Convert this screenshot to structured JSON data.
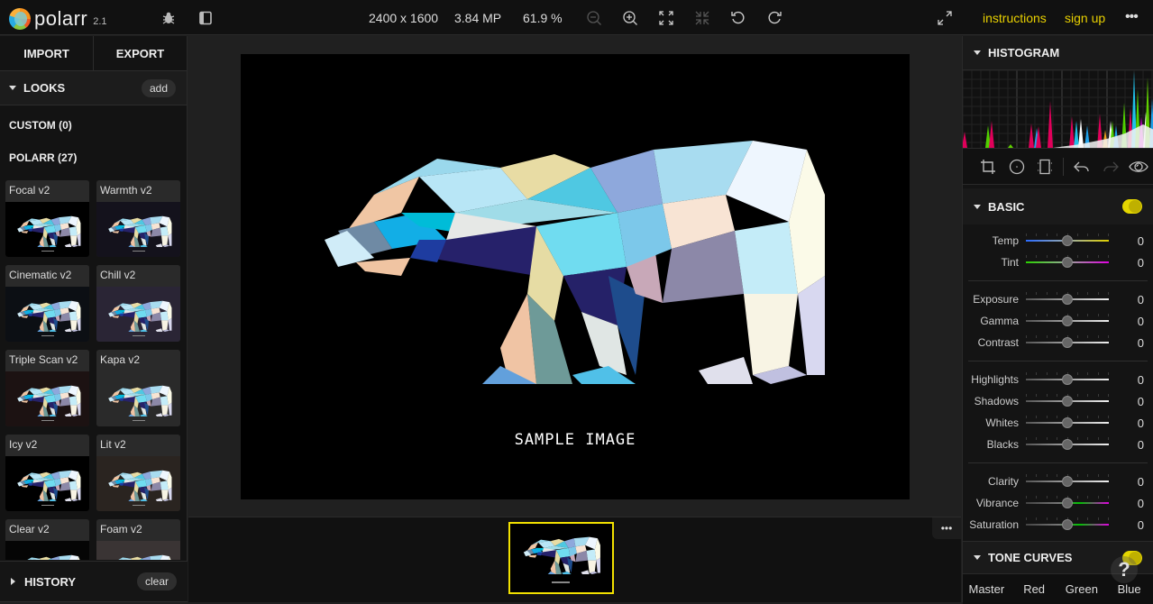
{
  "app": {
    "name": "polarr",
    "version": "2.1"
  },
  "topbar": {
    "dimensions": "2400 x 1600",
    "megapixels": "3.84 MP",
    "zoom": "61.9 %",
    "icons": [
      "bug-icon",
      "sidebar-toggle-icon",
      "zoom-out-icon",
      "zoom-in-icon",
      "fit-screen-icon",
      "actual-size-icon",
      "undo-icon",
      "redo-icon",
      "fullscreen-icon"
    ],
    "instructions_label": "instructions",
    "signup_label": "sign up",
    "more_label": "•••"
  },
  "left": {
    "import_label": "IMPORT",
    "export_label": "EXPORT",
    "looks_label": "LOOKS",
    "add_label": "add",
    "custom_label": "CUSTOM (0)",
    "polarr_label": "POLARR (27)",
    "looks": [
      {
        "name": "Focal v2",
        "bg": "#000000"
      },
      {
        "name": "Warmth v2",
        "bg": "#14121c"
      },
      {
        "name": "Cinematic v2",
        "bg": "#0c0f14"
      },
      {
        "name": "Chill v2",
        "bg": "#2a2535"
      },
      {
        "name": "Triple Scan v2",
        "bg": "#1c1212"
      },
      {
        "name": "Kapa v2",
        "bg": "#2a2a2a"
      },
      {
        "name": "Icy v2",
        "bg": "#000000"
      },
      {
        "name": "Lit v2",
        "bg": "#2a2420"
      },
      {
        "name": "Clear v2",
        "bg": "#050505"
      },
      {
        "name": "Foam v2",
        "bg": "#3a3434"
      }
    ],
    "history_label": "HISTORY",
    "clear_label": "clear"
  },
  "canvas": {
    "caption": "SAMPLE IMAGE",
    "filmstrip_more": "•••"
  },
  "right": {
    "histogram_label": "HISTOGRAM",
    "basic_label": "BASIC",
    "basic_enabled": true,
    "sliders": [
      {
        "label": "Temp",
        "value": "0",
        "group": 0,
        "gradient": "linear-gradient(to right,#2a6bff,#9aa 50%,#e0d000)"
      },
      {
        "label": "Tint",
        "value": "0",
        "group": 0,
        "gradient": "linear-gradient(to right,#2ad000,#9a9 50%,#e000e0)"
      },
      {
        "label": "Exposure",
        "value": "0",
        "group": 1
      },
      {
        "label": "Gamma",
        "value": "0",
        "group": 1
      },
      {
        "label": "Contrast",
        "value": "0",
        "group": 1
      },
      {
        "label": "Highlights",
        "value": "0",
        "group": 2
      },
      {
        "label": "Shadows",
        "value": "0",
        "group": 2
      },
      {
        "label": "Whites",
        "value": "0",
        "group": 2
      },
      {
        "label": "Blacks",
        "value": "0",
        "group": 2
      },
      {
        "label": "Clarity",
        "value": "0",
        "group": 3
      },
      {
        "label": "Vibrance",
        "value": "0",
        "group": 3,
        "gradient": "linear-gradient(to right,#444,#777 40%,#00c000 65%,#e000e0)"
      },
      {
        "label": "Saturation",
        "value": "0",
        "group": 3,
        "gradient": "linear-gradient(to right,#444,#777 40%,#00c000 65%,#e000e0)"
      }
    ],
    "tone_curves_label": "TONE CURVES",
    "tone_curves_enabled": true,
    "tone_tabs": [
      "Master",
      "Red",
      "Green",
      "Blue"
    ]
  },
  "help_label": "?"
}
